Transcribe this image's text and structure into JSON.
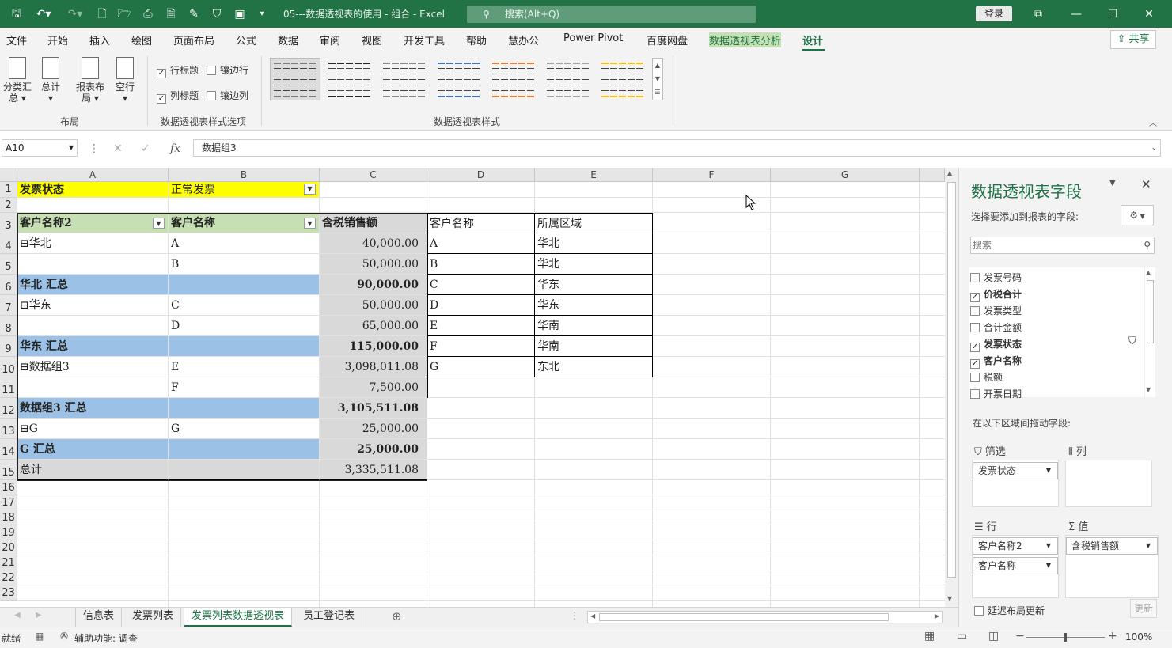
{
  "window": {
    "title": "05---数据透视表的使用 - 组合  -  Excel",
    "search_placeholder": "搜索(Alt+Q)",
    "login_label": "登录"
  },
  "menu": {
    "tabs": [
      "文件",
      "开始",
      "插入",
      "绘图",
      "页面布局",
      "公式",
      "数据",
      "审阅",
      "视图",
      "开发工具",
      "帮助",
      "慧办公",
      "Power Pivot",
      "百度网盘",
      "数据透视表分析",
      "设计"
    ],
    "active_tab": "设计",
    "share_label": "共享"
  },
  "ribbon": {
    "layout_buttons": [
      "分类汇总",
      "总计",
      "报表布局",
      "空行"
    ],
    "layout_group_label": "布局",
    "options": [
      {
        "label": "行标题",
        "checked": true
      },
      {
        "label": "镶边行",
        "checked": false
      },
      {
        "label": "列标题",
        "checked": true
      },
      {
        "label": "镶边列",
        "checked": false
      }
    ],
    "options_group_label": "数据透视表样式选项",
    "styles_group_label": "数据透视表样式",
    "style_colors": [
      "#7f7f7f",
      "#262626",
      "#8a8a8a",
      "#4472c4",
      "#ed7d31",
      "#a5a5a5",
      "#ffc000"
    ]
  },
  "formula_bar": {
    "name_box": "A10",
    "formula": "数据组3"
  },
  "columns": [
    "A",
    "B",
    "C",
    "D",
    "E",
    "F",
    "G"
  ],
  "rows": [
    "1",
    "2",
    "3",
    "4",
    "5",
    "6",
    "7",
    "8",
    "9",
    "10",
    "11",
    "12",
    "13",
    "14",
    "15",
    "16",
    "17",
    "18",
    "19",
    "20",
    "21",
    "22",
    "23"
  ],
  "cells": {
    "r1": {
      "a": "发票状态",
      "b": "正常发票"
    },
    "r3": {
      "a": "客户名称2",
      "b": "客户名称",
      "c": "含税销售额",
      "d": "客户名称",
      "e": "所属区域"
    },
    "r4": {
      "a": "⊟华北",
      "b": "A",
      "c": "40,000.00",
      "d": "A",
      "e": "华北"
    },
    "r5": {
      "b": "B",
      "c": "50,000.00",
      "d": "B",
      "e": "华北"
    },
    "r6": {
      "a": "华北 汇总",
      "c": "90,000.00",
      "d": "C",
      "e": "华东"
    },
    "r7": {
      "a": "⊟华东",
      "b": "C",
      "c": "50,000.00",
      "d": "D",
      "e": "华东"
    },
    "r8": {
      "b": "D",
      "c": "65,000.00",
      "d": "E",
      "e": "华南"
    },
    "r9": {
      "a": "华东 汇总",
      "c": "115,000.00",
      "d": "F",
      "e": "华南"
    },
    "r10": {
      "a": "⊟数据组3",
      "b": "E",
      "c": "3,098,011.08",
      "d": "G",
      "e": "东北"
    },
    "r11": {
      "b": "F",
      "c": "7,500.00"
    },
    "r12": {
      "a": "数据组3 汇总",
      "c": "3,105,511.08"
    },
    "r13": {
      "a": "⊟G",
      "b": "G",
      "c": "25,000.00"
    },
    "r14": {
      "a": "G 汇总",
      "c": "25,000.00"
    },
    "r15": {
      "a": "总计",
      "c": "3,335,511.08"
    }
  },
  "sheet_tabs": [
    "信息表",
    "发票列表",
    "发票列表数据透视表",
    "员工登记表"
  ],
  "active_sheet": "发票列表数据透视表",
  "status": {
    "ready": "就绪",
    "accessibility": "辅助功能: 调查",
    "zoom": "100%"
  },
  "pivot_panel": {
    "title": "数据透视表字段",
    "subtitle": "选择要添加到报表的字段:",
    "search_placeholder": "搜索",
    "fields": [
      {
        "label": "发票号码",
        "checked": false
      },
      {
        "label": "价税合计",
        "checked": true
      },
      {
        "label": "发票类型",
        "checked": false
      },
      {
        "label": "合计金额",
        "checked": false
      },
      {
        "label": "发票状态",
        "checked": true
      },
      {
        "label": "客户名称",
        "checked": true
      },
      {
        "label": "税额",
        "checked": false
      },
      {
        "label": "开票日期",
        "checked": false
      }
    ],
    "drag_hint": "在以下区域间拖动字段:",
    "filter_label": "筛选",
    "columns_label": "列",
    "rows_label": "行",
    "values_label": "值",
    "filter_items": [
      "发票状态"
    ],
    "row_items": [
      "客户名称2",
      "客户名称"
    ],
    "value_items": [
      "含税销售额"
    ],
    "defer_label": "延迟布局更新",
    "update_label": "更新"
  }
}
